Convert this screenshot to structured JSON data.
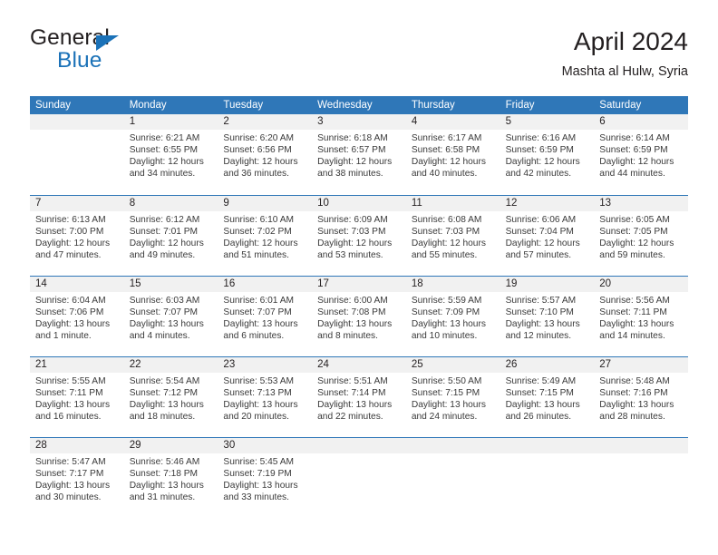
{
  "brand": {
    "line1": "General",
    "line2": "Blue",
    "accent_color": "#1b72b8",
    "triangle_icon": "brand-triangle-icon"
  },
  "header": {
    "title": "April 2024",
    "subtitle": "Mashta al Hulw, Syria"
  },
  "calendar": {
    "header_bg": "#2f77b8",
    "day_band_bg": "#f1f1f1",
    "weekdays": [
      "Sunday",
      "Monday",
      "Tuesday",
      "Wednesday",
      "Thursday",
      "Friday",
      "Saturday"
    ],
    "weeks": [
      [
        {
          "day": "",
          "sunrise": "",
          "sunset": "",
          "daylight": ""
        },
        {
          "day": "1",
          "sunrise": "Sunrise: 6:21 AM",
          "sunset": "Sunset: 6:55 PM",
          "daylight": "Daylight: 12 hours and 34 minutes."
        },
        {
          "day": "2",
          "sunrise": "Sunrise: 6:20 AM",
          "sunset": "Sunset: 6:56 PM",
          "daylight": "Daylight: 12 hours and 36 minutes."
        },
        {
          "day": "3",
          "sunrise": "Sunrise: 6:18 AM",
          "sunset": "Sunset: 6:57 PM",
          "daylight": "Daylight: 12 hours and 38 minutes."
        },
        {
          "day": "4",
          "sunrise": "Sunrise: 6:17 AM",
          "sunset": "Sunset: 6:58 PM",
          "daylight": "Daylight: 12 hours and 40 minutes."
        },
        {
          "day": "5",
          "sunrise": "Sunrise: 6:16 AM",
          "sunset": "Sunset: 6:59 PM",
          "daylight": "Daylight: 12 hours and 42 minutes."
        },
        {
          "day": "6",
          "sunrise": "Sunrise: 6:14 AM",
          "sunset": "Sunset: 6:59 PM",
          "daylight": "Daylight: 12 hours and 44 minutes."
        }
      ],
      [
        {
          "day": "7",
          "sunrise": "Sunrise: 6:13 AM",
          "sunset": "Sunset: 7:00 PM",
          "daylight": "Daylight: 12 hours and 47 minutes."
        },
        {
          "day": "8",
          "sunrise": "Sunrise: 6:12 AM",
          "sunset": "Sunset: 7:01 PM",
          "daylight": "Daylight: 12 hours and 49 minutes."
        },
        {
          "day": "9",
          "sunrise": "Sunrise: 6:10 AM",
          "sunset": "Sunset: 7:02 PM",
          "daylight": "Daylight: 12 hours and 51 minutes."
        },
        {
          "day": "10",
          "sunrise": "Sunrise: 6:09 AM",
          "sunset": "Sunset: 7:03 PM",
          "daylight": "Daylight: 12 hours and 53 minutes."
        },
        {
          "day": "11",
          "sunrise": "Sunrise: 6:08 AM",
          "sunset": "Sunset: 7:03 PM",
          "daylight": "Daylight: 12 hours and 55 minutes."
        },
        {
          "day": "12",
          "sunrise": "Sunrise: 6:06 AM",
          "sunset": "Sunset: 7:04 PM",
          "daylight": "Daylight: 12 hours and 57 minutes."
        },
        {
          "day": "13",
          "sunrise": "Sunrise: 6:05 AM",
          "sunset": "Sunset: 7:05 PM",
          "daylight": "Daylight: 12 hours and 59 minutes."
        }
      ],
      [
        {
          "day": "14",
          "sunrise": "Sunrise: 6:04 AM",
          "sunset": "Sunset: 7:06 PM",
          "daylight": "Daylight: 13 hours and 1 minute."
        },
        {
          "day": "15",
          "sunrise": "Sunrise: 6:03 AM",
          "sunset": "Sunset: 7:07 PM",
          "daylight": "Daylight: 13 hours and 4 minutes."
        },
        {
          "day": "16",
          "sunrise": "Sunrise: 6:01 AM",
          "sunset": "Sunset: 7:07 PM",
          "daylight": "Daylight: 13 hours and 6 minutes."
        },
        {
          "day": "17",
          "sunrise": "Sunrise: 6:00 AM",
          "sunset": "Sunset: 7:08 PM",
          "daylight": "Daylight: 13 hours and 8 minutes."
        },
        {
          "day": "18",
          "sunrise": "Sunrise: 5:59 AM",
          "sunset": "Sunset: 7:09 PM",
          "daylight": "Daylight: 13 hours and 10 minutes."
        },
        {
          "day": "19",
          "sunrise": "Sunrise: 5:57 AM",
          "sunset": "Sunset: 7:10 PM",
          "daylight": "Daylight: 13 hours and 12 minutes."
        },
        {
          "day": "20",
          "sunrise": "Sunrise: 5:56 AM",
          "sunset": "Sunset: 7:11 PM",
          "daylight": "Daylight: 13 hours and 14 minutes."
        }
      ],
      [
        {
          "day": "21",
          "sunrise": "Sunrise: 5:55 AM",
          "sunset": "Sunset: 7:11 PM",
          "daylight": "Daylight: 13 hours and 16 minutes."
        },
        {
          "day": "22",
          "sunrise": "Sunrise: 5:54 AM",
          "sunset": "Sunset: 7:12 PM",
          "daylight": "Daylight: 13 hours and 18 minutes."
        },
        {
          "day": "23",
          "sunrise": "Sunrise: 5:53 AM",
          "sunset": "Sunset: 7:13 PM",
          "daylight": "Daylight: 13 hours and 20 minutes."
        },
        {
          "day": "24",
          "sunrise": "Sunrise: 5:51 AM",
          "sunset": "Sunset: 7:14 PM",
          "daylight": "Daylight: 13 hours and 22 minutes."
        },
        {
          "day": "25",
          "sunrise": "Sunrise: 5:50 AM",
          "sunset": "Sunset: 7:15 PM",
          "daylight": "Daylight: 13 hours and 24 minutes."
        },
        {
          "day": "26",
          "sunrise": "Sunrise: 5:49 AM",
          "sunset": "Sunset: 7:15 PM",
          "daylight": "Daylight: 13 hours and 26 minutes."
        },
        {
          "day": "27",
          "sunrise": "Sunrise: 5:48 AM",
          "sunset": "Sunset: 7:16 PM",
          "daylight": "Daylight: 13 hours and 28 minutes."
        }
      ],
      [
        {
          "day": "28",
          "sunrise": "Sunrise: 5:47 AM",
          "sunset": "Sunset: 7:17 PM",
          "daylight": "Daylight: 13 hours and 30 minutes."
        },
        {
          "day": "29",
          "sunrise": "Sunrise: 5:46 AM",
          "sunset": "Sunset: 7:18 PM",
          "daylight": "Daylight: 13 hours and 31 minutes."
        },
        {
          "day": "30",
          "sunrise": "Sunrise: 5:45 AM",
          "sunset": "Sunset: 7:19 PM",
          "daylight": "Daylight: 13 hours and 33 minutes."
        },
        {
          "day": "",
          "sunrise": "",
          "sunset": "",
          "daylight": ""
        },
        {
          "day": "",
          "sunrise": "",
          "sunset": "",
          "daylight": ""
        },
        {
          "day": "",
          "sunrise": "",
          "sunset": "",
          "daylight": ""
        },
        {
          "day": "",
          "sunrise": "",
          "sunset": "",
          "daylight": ""
        }
      ]
    ]
  }
}
